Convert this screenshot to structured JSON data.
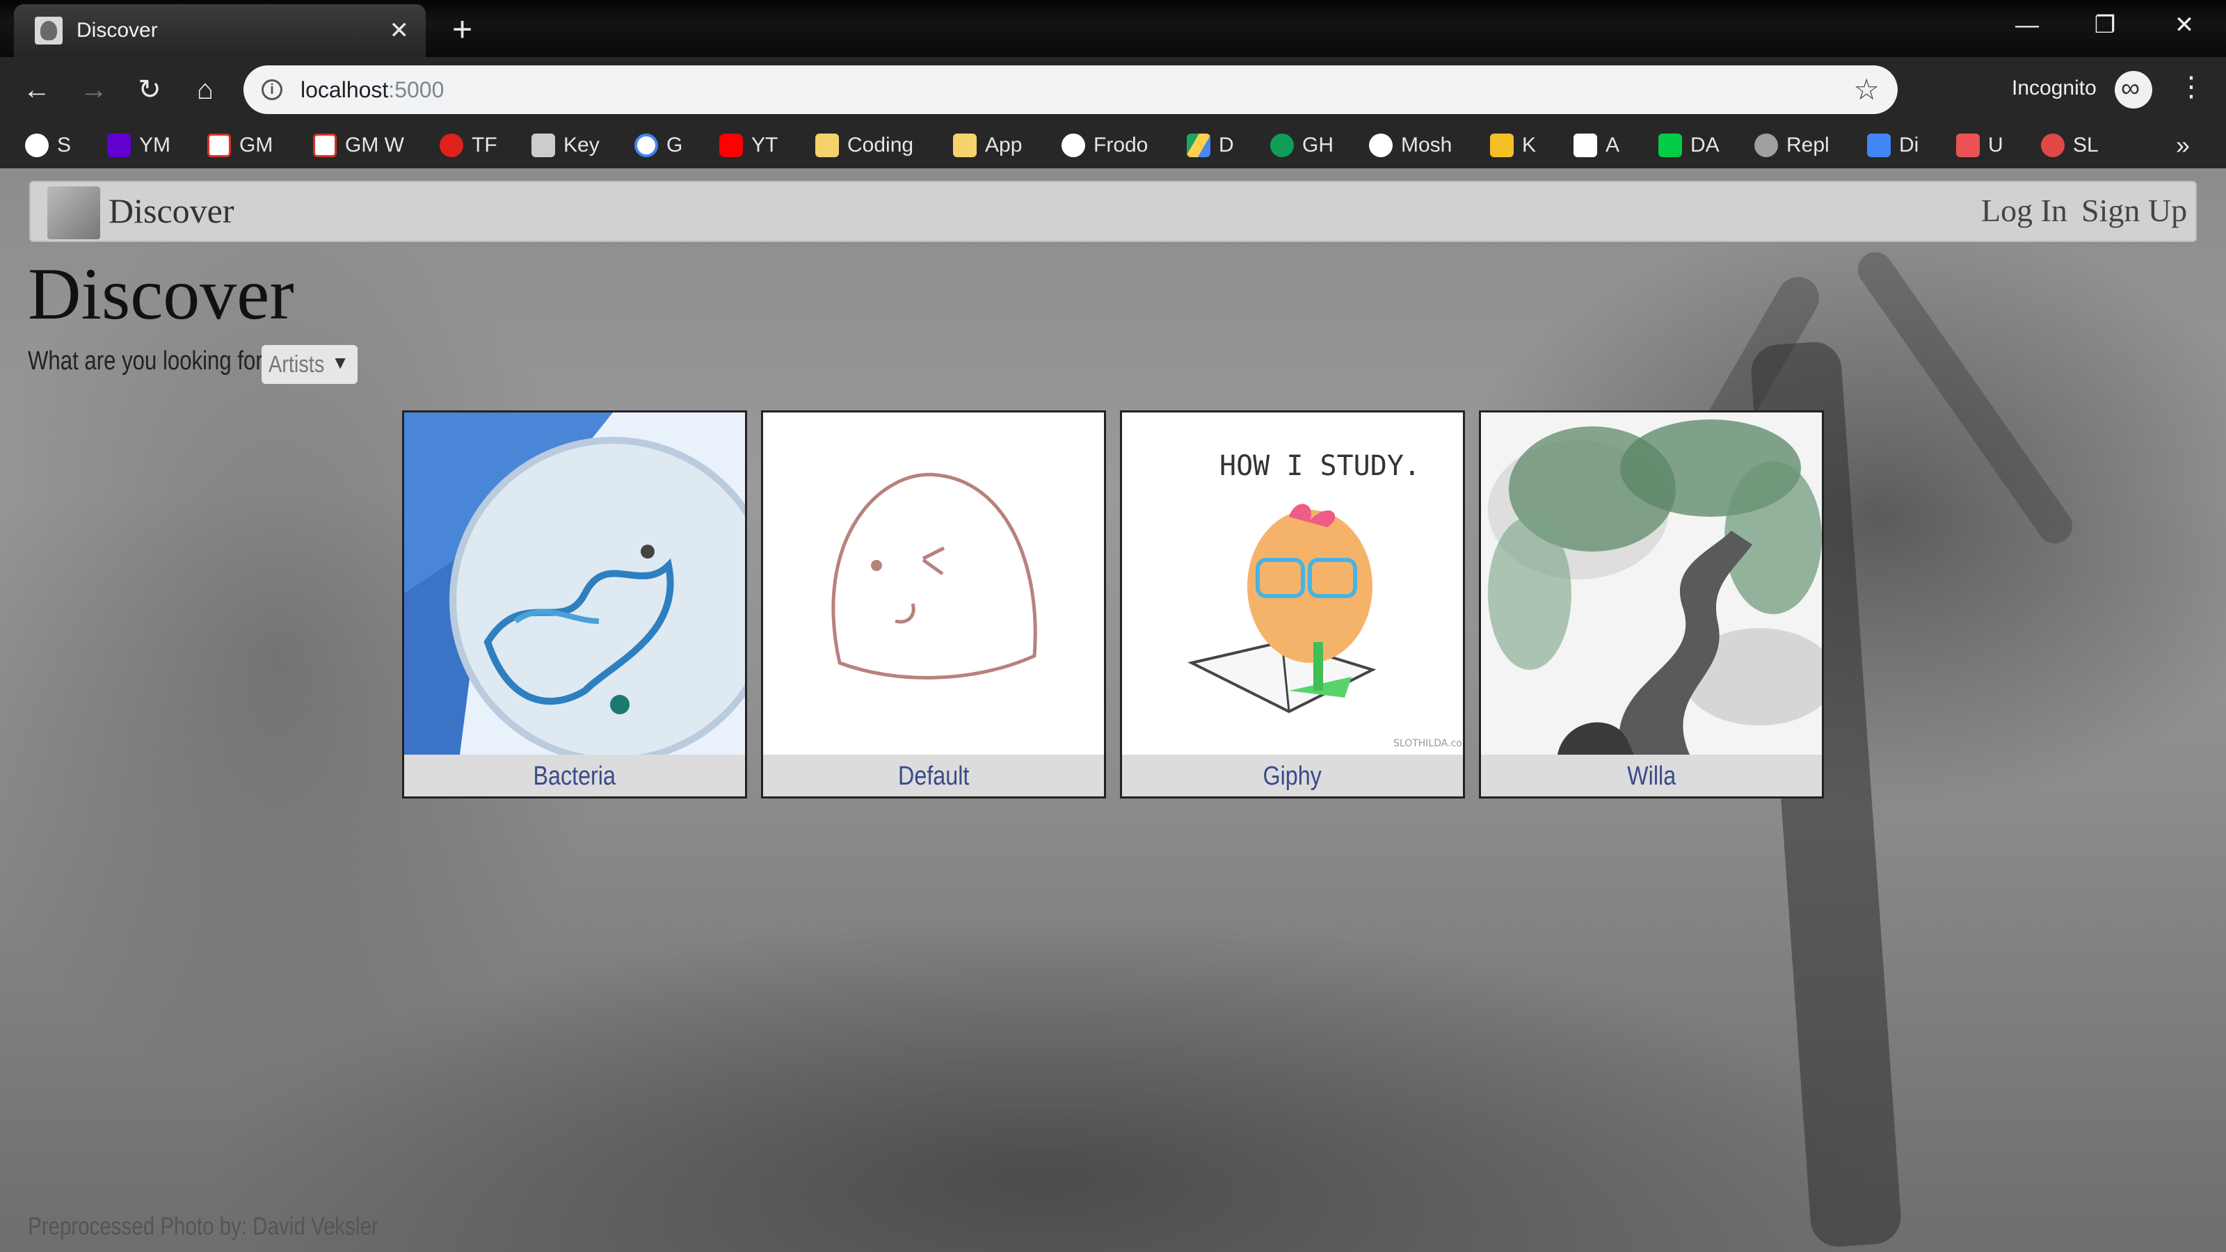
{
  "browser": {
    "tab_title": "Discover",
    "url_host": "localhost",
    "url_port": ":5000",
    "profile_label": "Incognito",
    "bookmarks": [
      {
        "label": "S",
        "icon": "globe-icon",
        "color": "#ffffff"
      },
      {
        "label": "YM",
        "icon": "yahoo-icon",
        "color": "#6001d2"
      },
      {
        "label": "GM",
        "icon": "gmail-icon",
        "color": "#d93025"
      },
      {
        "label": "GM W",
        "icon": "gmail-icon",
        "color": "#d93025"
      },
      {
        "label": "TF",
        "icon": "tf-icon",
        "color": "#e0201b"
      },
      {
        "label": "Key",
        "icon": "key-icon",
        "color": "#cccccc"
      },
      {
        "label": "G",
        "icon": "google-icon",
        "color": "#4285f4"
      },
      {
        "label": "YT",
        "icon": "youtube-icon",
        "color": "#ff0000"
      },
      {
        "label": "Coding",
        "icon": "folder-icon",
        "color": "#f5d36b"
      },
      {
        "label": "App",
        "icon": "folder-icon",
        "color": "#f5d36b"
      },
      {
        "label": "Frodo",
        "icon": "globe-icon",
        "color": "#ffffff"
      },
      {
        "label": "D",
        "icon": "drive-icon",
        "color": "#1fa463"
      },
      {
        "label": "GH",
        "icon": "hangouts-icon",
        "color": "#0f9d58"
      },
      {
        "label": "Mosh",
        "icon": "globe-icon",
        "color": "#ffffff"
      },
      {
        "label": "K",
        "icon": "keep-icon",
        "color": "#f6bf26"
      },
      {
        "label": "A",
        "icon": "amazon-icon",
        "color": "#ffffff"
      },
      {
        "label": "DA",
        "icon": "deviantart-icon",
        "color": "#05cc47"
      },
      {
        "label": "Repl",
        "icon": "repl-icon",
        "color": "#a0a0a0"
      },
      {
        "label": "Di",
        "icon": "calendar-icon",
        "color": "#4285f4"
      },
      {
        "label": "U",
        "icon": "udemy-icon",
        "color": "#ec5252"
      },
      {
        "label": "SL",
        "icon": "sl-icon",
        "color": "#e04848"
      }
    ]
  },
  "navbar": {
    "brand": "Discover",
    "login": "Log In",
    "signup": "Sign Up"
  },
  "main": {
    "title": "Discover",
    "prompt_label": "What are you looking for?",
    "prompt_selected": "Artists",
    "cards": [
      {
        "label": "Bacteria"
      },
      {
        "label": "Default"
      },
      {
        "label": "Giphy",
        "art_text": "HOW I STUDY.",
        "art_small": "SLOTHILDA.com"
      },
      {
        "label": "Willa"
      }
    ]
  },
  "footer": {
    "credit": "Preprocessed Photo by: David Veksler"
  },
  "colors": {
    "card_label": "#3a4a8a",
    "navbar_bg": "#d7d7d7"
  }
}
